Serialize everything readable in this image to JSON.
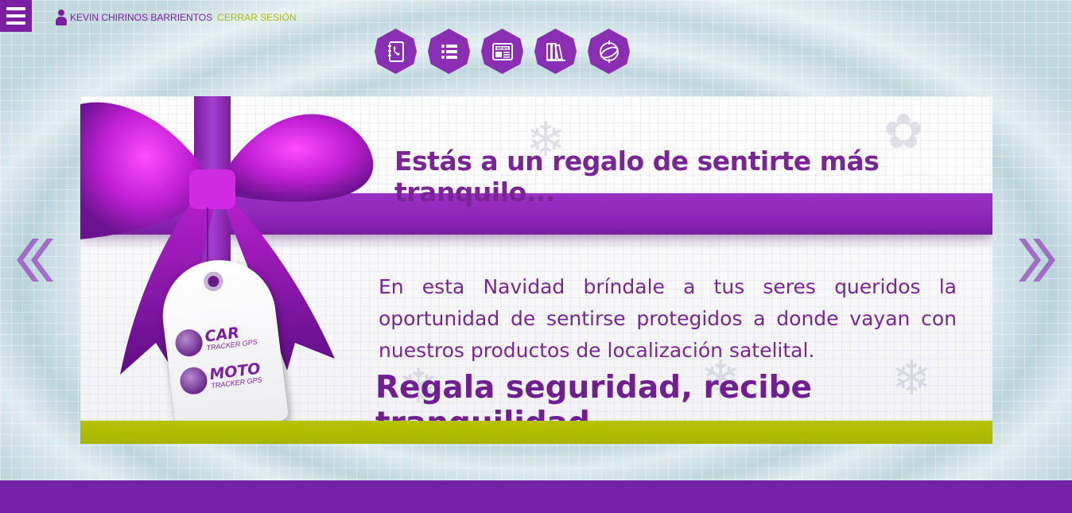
{
  "header": {
    "menu_label": "Menú",
    "user_name": "KEVIN CHIRINOS BARRIENTOS",
    "logout_label": "CERRAR SESIÓN"
  },
  "nav_icons": [
    {
      "name": "contacts-icon"
    },
    {
      "name": "list-icon"
    },
    {
      "name": "news-icon",
      "label": "NEWS"
    },
    {
      "name": "library-icon"
    },
    {
      "name": "satellite-icon"
    }
  ],
  "carousel": {
    "prev_label": "«",
    "next_label": "»",
    "slide": {
      "headline": "Estás a un regalo de sentirte más tranquilo...",
      "body": "En esta Navidad bríndale a tus seres queridos la oportunidad de sentirse protegidos a donde vayan con nuestros productos de localización satelital.",
      "tagline": "Regala seguridad, recibe tranquilidad...",
      "tag": {
        "car_title": "CAR",
        "car_sub": "TRACKER GPS",
        "moto_title": "MOTO",
        "moto_sub": "TRACKER GPS"
      }
    }
  },
  "colors": {
    "brand_purple": "#7a1fa2",
    "accent_green": "#a8b900",
    "footer_purple": "#7421a5"
  }
}
